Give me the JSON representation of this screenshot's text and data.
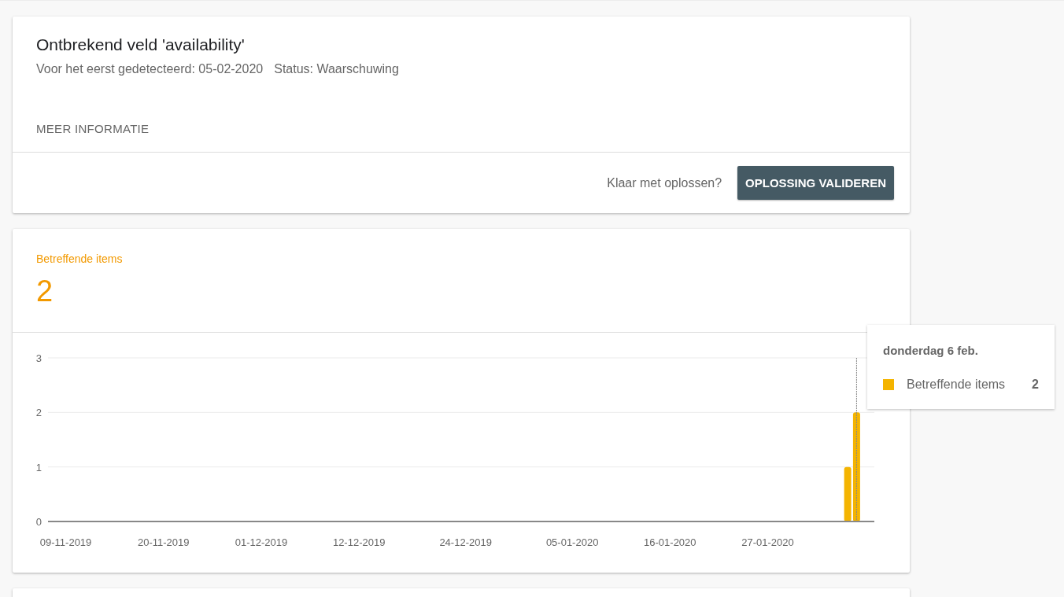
{
  "issue_card": {
    "title": "Ontbrekend veld 'availability'",
    "first_detected": "Voor het eerst gedetecteerd: 05-02-2020",
    "status": "Status: Waarschuwing",
    "more_info_link": "MEER INFORMATIE",
    "prompt": "Klaar met oplossen?",
    "validate_button": "OPLOSSING VALIDEREN"
  },
  "items_card": {
    "label": "Betreffende items",
    "count": "2",
    "chart_data": {
      "type": "bar",
      "ylim": [
        0,
        3
      ],
      "yticks": [
        0,
        1,
        2,
        3
      ],
      "categories": [
        "09-11-2019",
        null,
        null,
        null,
        null,
        null,
        null,
        null,
        null,
        null,
        null,
        "20-11-2019",
        null,
        null,
        null,
        null,
        null,
        null,
        null,
        null,
        null,
        null,
        "01-12-2019",
        null,
        null,
        null,
        null,
        null,
        null,
        null,
        null,
        null,
        null,
        "12-12-2019",
        null,
        null,
        null,
        null,
        null,
        null,
        null,
        null,
        null,
        null,
        null,
        "24-12-2019",
        null,
        null,
        null,
        null,
        null,
        null,
        null,
        null,
        null,
        null,
        null,
        "05-01-2020",
        null,
        null,
        null,
        null,
        null,
        null,
        null,
        null,
        null,
        null,
        "16-01-2020",
        null,
        null,
        null,
        null,
        null,
        null,
        null,
        null,
        null,
        null,
        "27-01-2020",
        null,
        null,
        null,
        null,
        null,
        null,
        null,
        null,
        null,
        null
      ],
      "series": [
        {
          "name": "Betreffende items",
          "color": "#f4b400",
          "values": [
            0,
            0,
            0,
            0,
            0,
            0,
            0,
            0,
            0,
            0,
            0,
            0,
            0,
            0,
            0,
            0,
            0,
            0,
            0,
            0,
            0,
            0,
            0,
            0,
            0,
            0,
            0,
            0,
            0,
            0,
            0,
            0,
            0,
            0,
            0,
            0,
            0,
            0,
            0,
            0,
            0,
            0,
            0,
            0,
            0,
            0,
            0,
            0,
            0,
            0,
            0,
            0,
            0,
            0,
            0,
            0,
            0,
            0,
            0,
            0,
            0,
            0,
            0,
            0,
            0,
            0,
            0,
            0,
            0,
            0,
            0,
            0,
            0,
            0,
            0,
            0,
            0,
            0,
            0,
            0,
            0,
            0,
            0,
            0,
            0,
            0,
            0,
            0,
            1,
            2
          ]
        }
      ]
    },
    "tooltip": {
      "title": "donderdag 6 feb.",
      "value": "2"
    }
  }
}
